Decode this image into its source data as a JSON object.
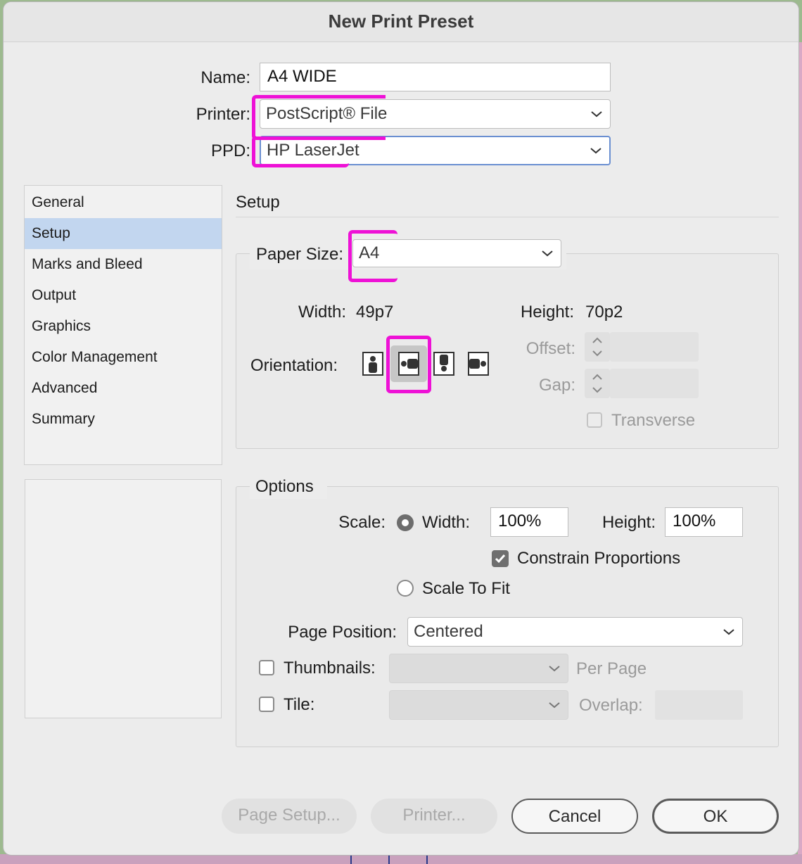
{
  "window": {
    "title": "New Print Preset"
  },
  "top": {
    "name_label": "Name:",
    "name_value": "A4 WIDE",
    "printer_label": "Printer:",
    "printer_value": "PostScript® File",
    "ppd_label": "PPD:",
    "ppd_value": "HP LaserJet"
  },
  "sidebar": {
    "items": [
      {
        "label": "General"
      },
      {
        "label": "Setup",
        "selected": true
      },
      {
        "label": "Marks and Bleed"
      },
      {
        "label": "Output"
      },
      {
        "label": "Graphics"
      },
      {
        "label": "Color Management"
      },
      {
        "label": "Advanced"
      },
      {
        "label": "Summary"
      }
    ]
  },
  "setup": {
    "title": "Setup",
    "paper_size_label": "Paper Size:",
    "paper_size_value": "A4",
    "width_label": "Width:",
    "width_value": "49p7",
    "height_label": "Height:",
    "height_value": "70p2",
    "orientation_label": "Orientation:",
    "orientation_options": [
      "portrait-icon",
      "landscape-icon",
      "reverse-portrait-icon",
      "reverse-landscape-icon"
    ],
    "orientation_selected": "landscape-icon",
    "offset_label": "Offset:",
    "gap_label": "Gap:",
    "transverse_label": "Transverse"
  },
  "options": {
    "title": "Options",
    "scale_label": "Scale:",
    "width_label": "Width:",
    "width_value": "100%",
    "height_label": "Height:",
    "height_value": "100%",
    "constrain_label": "Constrain Proportions",
    "constrain_checked": true,
    "scale_to_fit_label": "Scale To Fit",
    "page_position_label": "Page Position:",
    "page_position_value": "Centered",
    "thumbnails_label": "Thumbnails:",
    "per_page_label": "Per Page",
    "tile_label": "Tile:",
    "overlap_label": "Overlap:"
  },
  "buttons": {
    "page_setup": "Page Setup...",
    "printer": "Printer...",
    "cancel": "Cancel",
    "ok": "OK"
  },
  "colors": {
    "annotation": "#ee11d6",
    "selection": "#c2d6ef",
    "focus": "#6a8fd1"
  }
}
